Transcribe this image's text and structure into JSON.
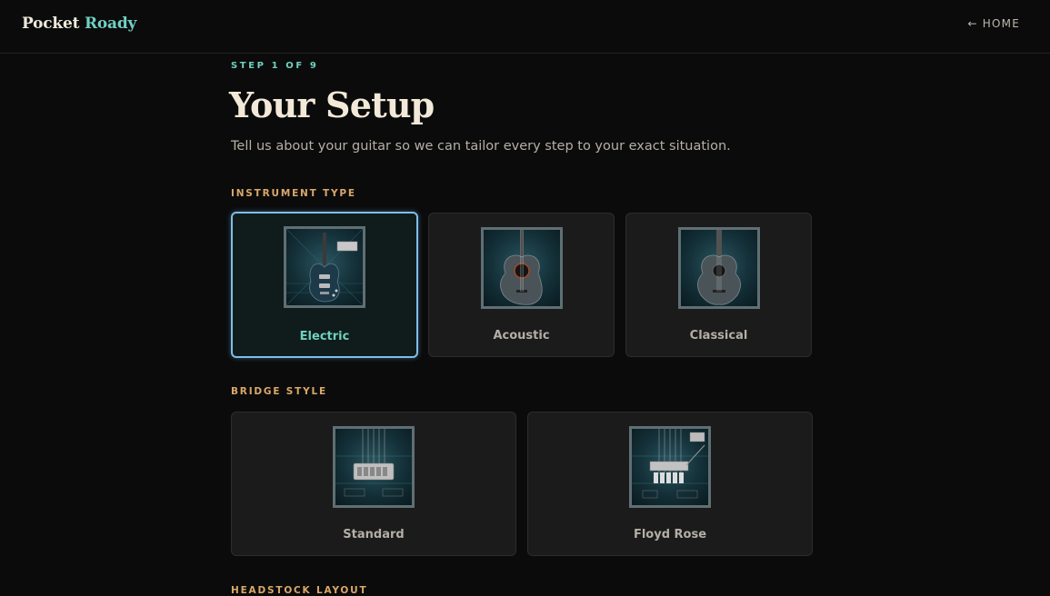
{
  "header": {
    "brand_part1": "Pocket",
    "brand_part2": "Roady",
    "home_arrow": "←",
    "home_label": "HOME"
  },
  "page": {
    "step": "STEP 1 OF 9",
    "title": "Your Setup",
    "subtitle": "Tell us about your guitar so we can tailor every step to your exact situation."
  },
  "sections": {
    "instrument_type": {
      "label": "INSTRUMENT TYPE",
      "options": [
        {
          "label": "Electric",
          "selected": true,
          "icon": "electric-guitar-icon"
        },
        {
          "label": "Acoustic",
          "selected": false,
          "icon": "acoustic-guitar-icon"
        },
        {
          "label": "Classical",
          "selected": false,
          "icon": "classical-guitar-icon"
        }
      ]
    },
    "bridge_style": {
      "label": "BRIDGE STYLE",
      "options": [
        {
          "label": "Standard",
          "selected": false,
          "icon": "standard-bridge-icon"
        },
        {
          "label": "Floyd Rose",
          "selected": false,
          "icon": "floyd-rose-bridge-icon"
        }
      ]
    },
    "headstock_layout": {
      "label": "HEADSTOCK LAYOUT"
    }
  },
  "colors": {
    "background": "#0b0b0b",
    "accent_teal": "#6fd0c0",
    "section_label": "#d9a86a",
    "selected_border": "#7fbde8"
  }
}
